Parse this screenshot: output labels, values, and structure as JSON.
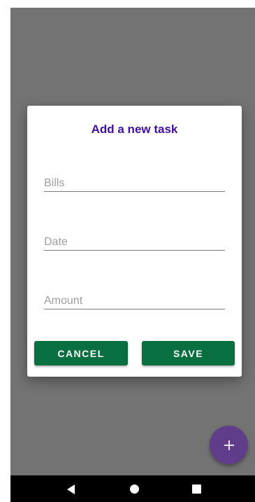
{
  "dialog": {
    "title": "Add a new task",
    "fields": {
      "bills": {
        "placeholder": "Bills",
        "value": ""
      },
      "date": {
        "placeholder": "Date",
        "value": ""
      },
      "amount": {
        "placeholder": "Amount",
        "value": ""
      }
    },
    "buttons": {
      "cancel": "CANCEL",
      "save": "SAVE"
    }
  },
  "fab": {
    "icon": "plus-icon"
  },
  "navigation_bar": {
    "back": "back-triangle-icon",
    "home": "home-circle-icon",
    "recents": "recents-square-icon"
  },
  "colors": {
    "title": "#3f0fa6",
    "button": "#087040",
    "fab": "#5f3d8a",
    "scrim": "#505050"
  }
}
